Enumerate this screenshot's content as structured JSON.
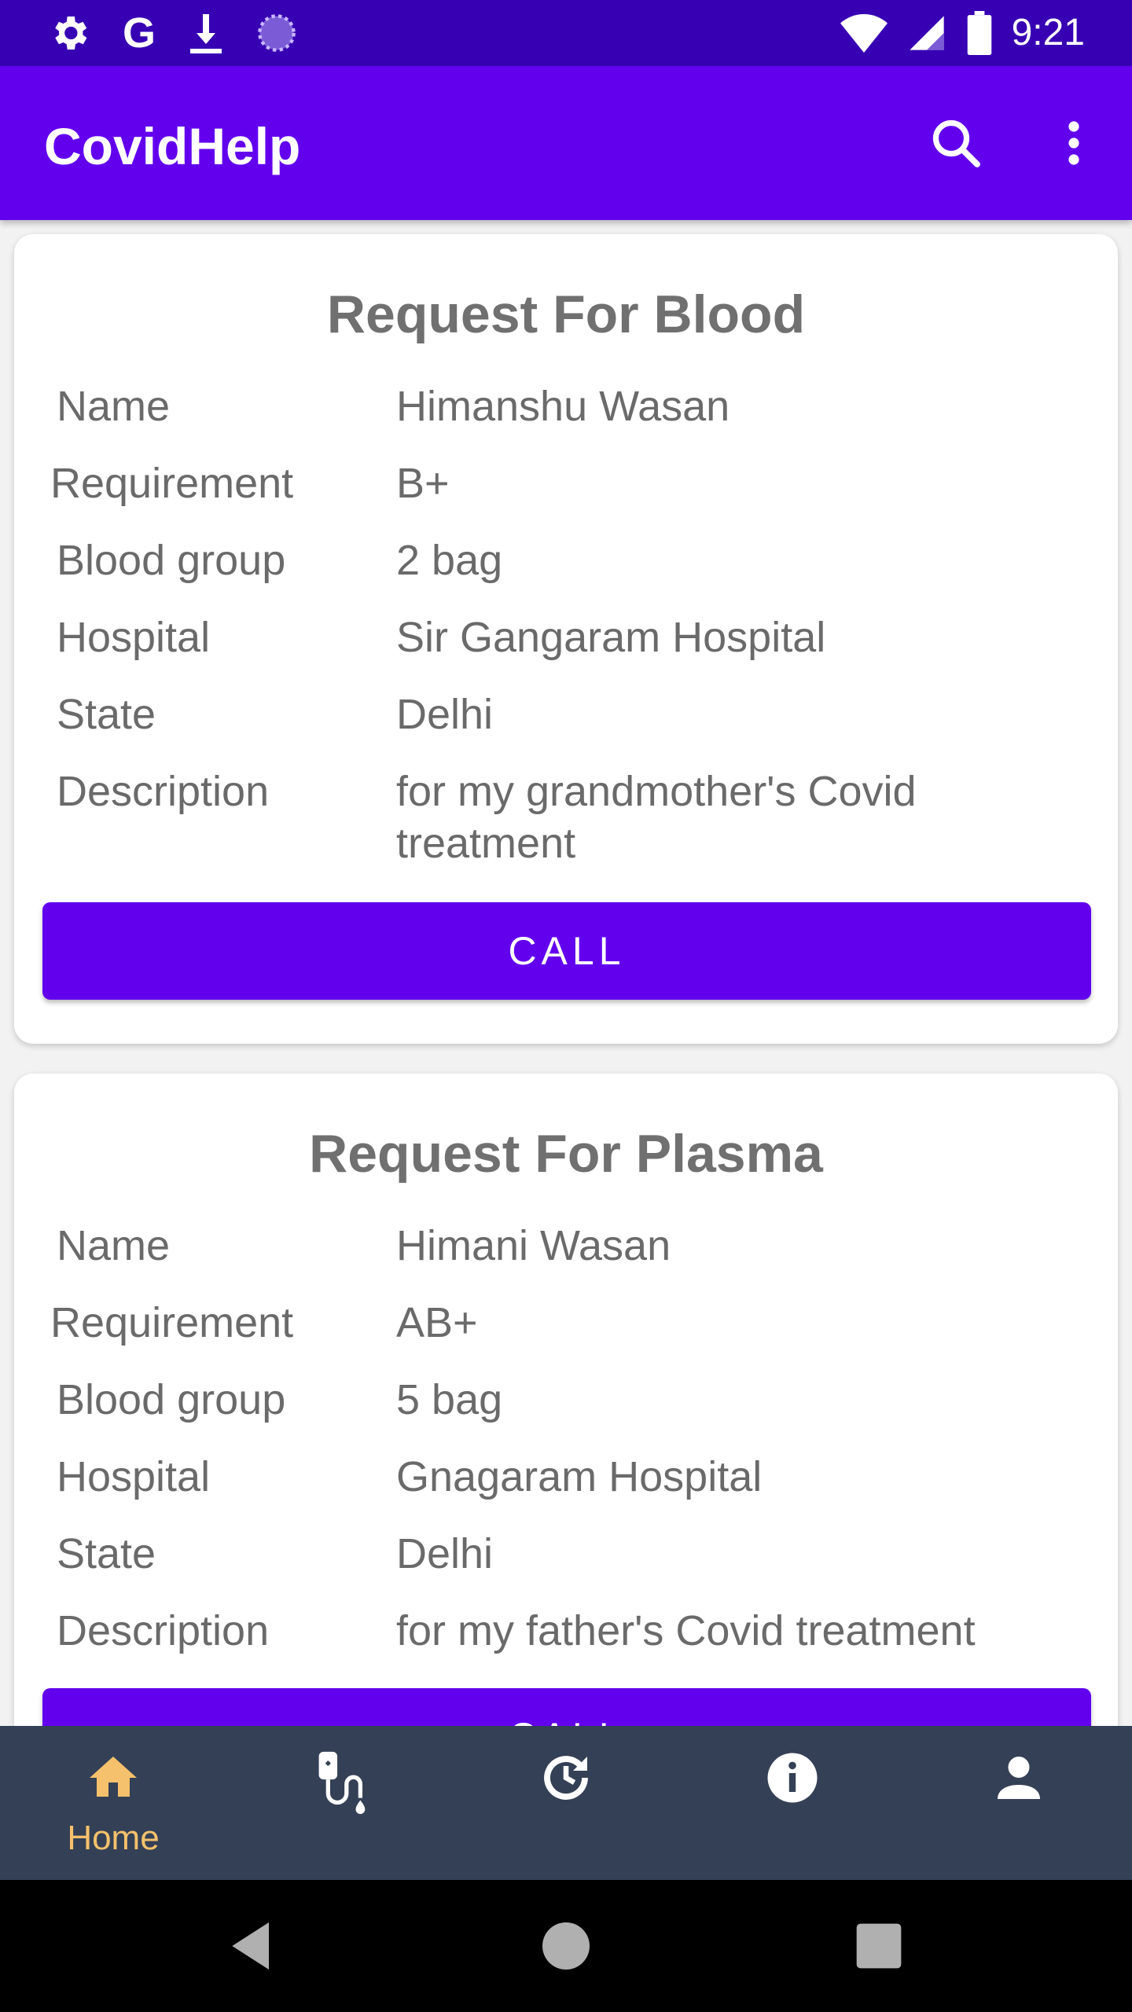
{
  "status_bar": {
    "time": "9:21",
    "left_icons": [
      "settings-icon",
      "google-icon",
      "download-icon",
      "sync-icon"
    ],
    "google_glyph": "G",
    "right_icons": [
      "wifi-icon",
      "signal-icon",
      "battery-icon"
    ]
  },
  "app_bar": {
    "title": "CovidHelp",
    "actions": [
      "search-icon",
      "more-vert-icon"
    ],
    "color": "#6200ee"
  },
  "cards": [
    {
      "title": "Request For Blood",
      "rows": [
        {
          "label": "Name",
          "value": "Himanshu Wasan"
        },
        {
          "label": "Requirement",
          "value": "B+"
        },
        {
          "label": "Blood group",
          "value": "2 bag"
        },
        {
          "label": "Hospital",
          "value": "Sir Gangaram Hospital"
        },
        {
          "label": "State",
          "value": "Delhi"
        },
        {
          "label": "Description",
          "value": "for my grandmother's Covid treatment"
        }
      ],
      "button": "CALL"
    },
    {
      "title": "Request For Plasma",
      "rows": [
        {
          "label": "Name",
          "value": "Himani Wasan"
        },
        {
          "label": "Requirement",
          "value": "AB+"
        },
        {
          "label": "Blood group",
          "value": "5 bag"
        },
        {
          "label": "Hospital",
          "value": "Gnagaram Hospital"
        },
        {
          "label": "State",
          "value": "Delhi"
        },
        {
          "label": "Description",
          "value": "for my father's Covid treatment"
        }
      ],
      "button": "CALL"
    }
  ],
  "bottom_nav": {
    "items": [
      {
        "icon": "home-icon",
        "label": "Home",
        "active": true
      },
      {
        "icon": "blood-drip-icon",
        "active": false
      },
      {
        "icon": "history-icon",
        "active": false
      },
      {
        "icon": "info-icon",
        "active": false
      },
      {
        "icon": "profile-icon",
        "active": false
      }
    ],
    "active_color": "#f5c16c",
    "background": "#344055"
  },
  "system_nav": [
    "back-icon",
    "home-circle-icon",
    "recents-icon"
  ]
}
